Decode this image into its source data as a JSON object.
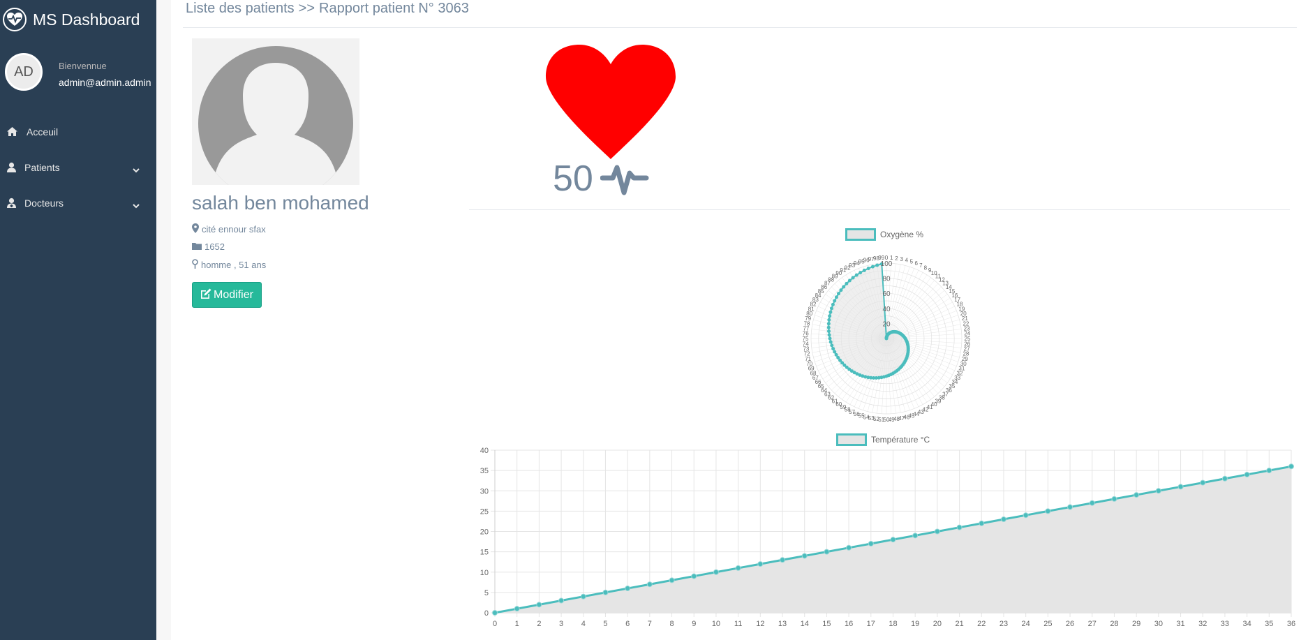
{
  "brand": {
    "title": "MS Dashboard",
    "icon": "heartbeat-icon"
  },
  "user": {
    "initials": "AD",
    "welcome": "Bienvennue",
    "email": "admin@admin.admin"
  },
  "nav": {
    "items": [
      {
        "label": "Acceuil",
        "icon": "home-icon"
      },
      {
        "label": "Patients",
        "icon": "user-icon"
      },
      {
        "label": "Docteurs",
        "icon": "doctor-icon"
      }
    ]
  },
  "breadcrumb": {
    "list": "Liste des patients",
    "separator": ">>",
    "current": "Rapport patient N° 3063"
  },
  "patient": {
    "name": "salah ben mohamed",
    "address": "cité ennour sfax",
    "file": "1652",
    "gender_age": "homme , 51 ans",
    "edit_label": "Modifier"
  },
  "heart_rate": {
    "value": "50"
  },
  "colors": {
    "accent": "#4bbdbd",
    "fill": "#e5e5e5",
    "sidebar": "#2a3f54",
    "button": "#26b99a",
    "heart": "#ff0000"
  },
  "chart_data": [
    {
      "type": "radar",
      "legend": "Oxygène %",
      "labels_note": "index 0..99",
      "values": [
        0,
        1,
        2,
        3,
        4,
        5,
        6,
        7,
        8,
        9,
        10,
        11,
        12,
        13,
        14,
        15,
        16,
        17,
        18,
        19,
        20,
        21,
        22,
        23,
        24,
        25,
        26,
        27,
        28,
        29,
        30,
        31,
        32,
        33,
        34,
        35,
        36,
        37,
        38,
        39,
        40,
        41,
        42,
        43,
        44,
        45,
        46,
        47,
        48,
        49,
        50,
        51,
        52,
        53,
        54,
        55,
        56,
        57,
        58,
        59,
        60,
        61,
        62,
        63,
        64,
        65,
        66,
        67,
        68,
        69,
        70,
        71,
        72,
        73,
        74,
        75,
        76,
        77,
        78,
        79,
        80,
        81,
        82,
        83,
        84,
        85,
        86,
        87,
        88,
        89,
        90,
        91,
        92,
        93,
        94,
        95,
        96,
        97,
        98,
        99
      ],
      "r_ticks": [
        "20",
        "40",
        "60",
        "80",
        "100"
      ],
      "rlim": [
        0,
        100
      ]
    },
    {
      "type": "area",
      "legend": "Température °C",
      "x": [
        0,
        1,
        2,
        3,
        4,
        5,
        6,
        7,
        8,
        9,
        10,
        11,
        12,
        13,
        14,
        15,
        16,
        17,
        18,
        19,
        20,
        21,
        22,
        23,
        24,
        25,
        26,
        27,
        28,
        29,
        30,
        31,
        32,
        33,
        34,
        35,
        36
      ],
      "values": [
        0,
        1,
        2,
        3,
        4,
        5,
        6,
        7,
        8,
        9,
        10,
        11,
        12,
        13,
        14,
        15,
        16,
        17,
        18,
        19,
        20,
        21,
        22,
        23,
        24,
        25,
        26,
        27,
        28,
        29,
        30,
        31,
        32,
        33,
        34,
        35,
        36
      ],
      "y_ticks": [
        "0",
        "5",
        "10",
        "15",
        "20",
        "25",
        "30",
        "35",
        "40"
      ],
      "ylim": [
        0,
        40
      ],
      "grid": true
    }
  ]
}
